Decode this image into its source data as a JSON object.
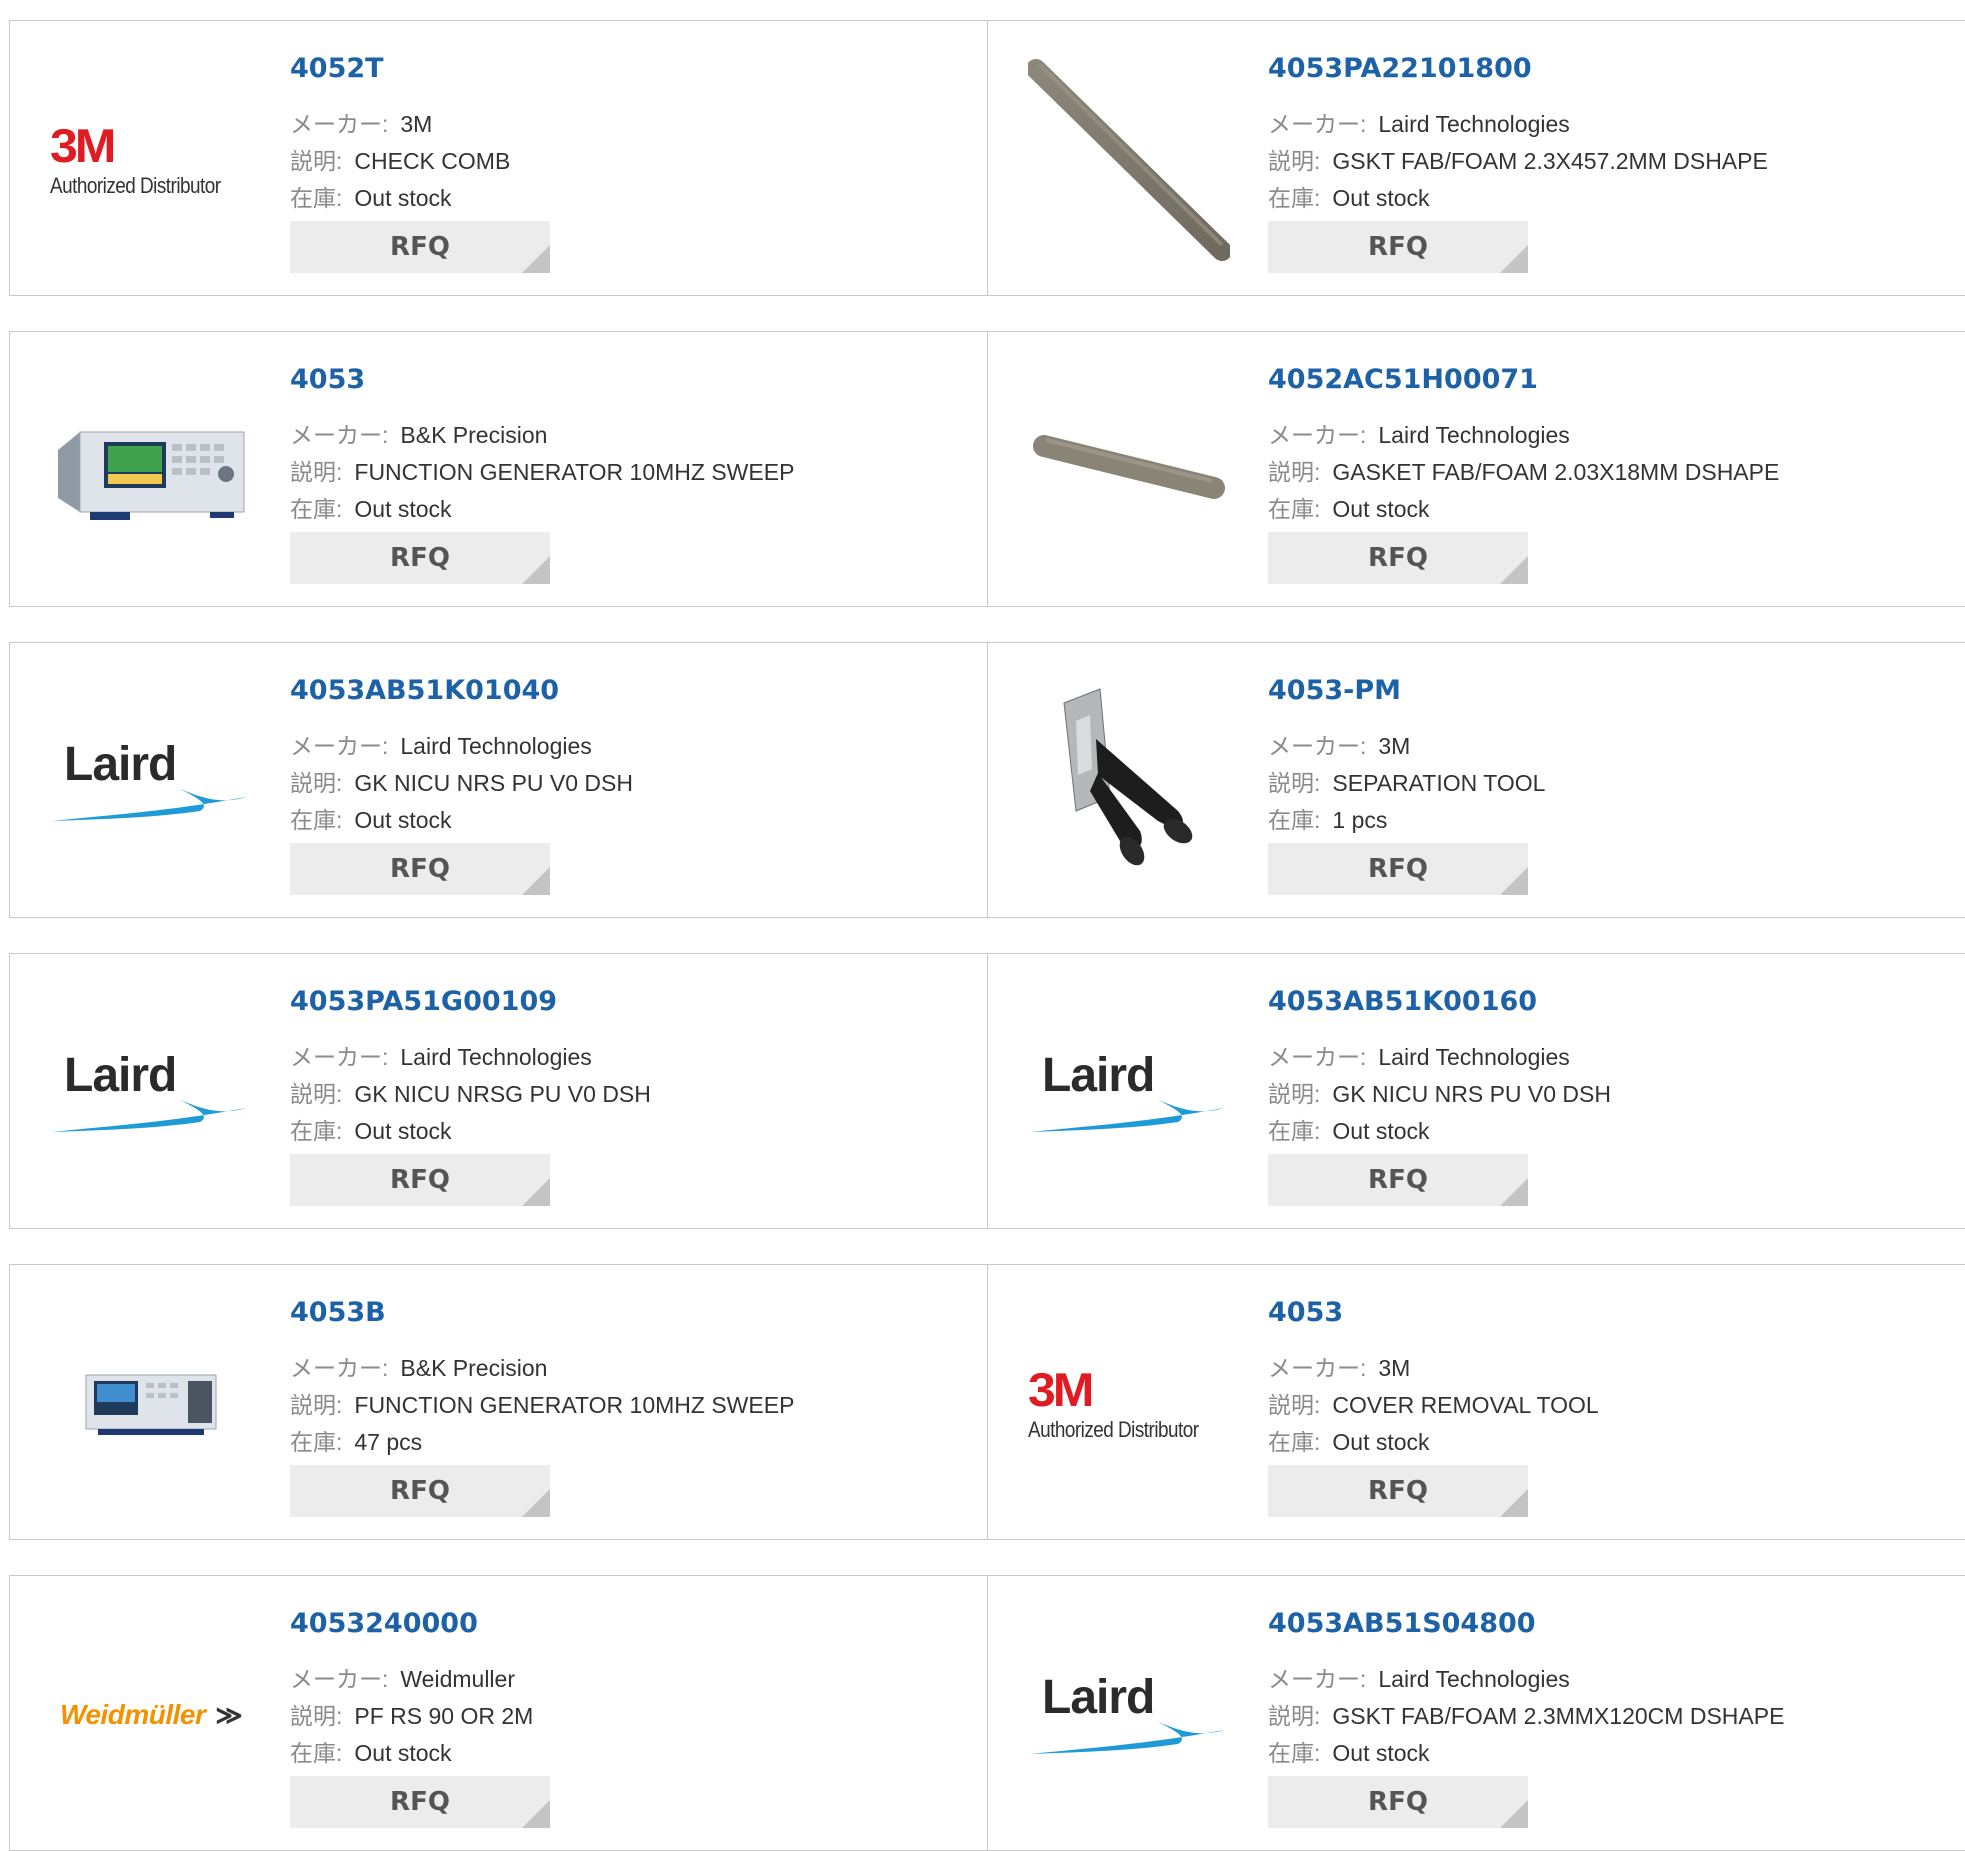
{
  "labels": {
    "maker": "メーカー:",
    "description": "説明:",
    "stock": "在庫:",
    "rfq": "RFQ"
  },
  "logos": {
    "3m_mark": "3M",
    "3m_text": "Authorized Distributor",
    "laird_text": "Laird",
    "weidmuller_text": "Weidmüller",
    "weidmuller_mark": "≫"
  },
  "products": [
    {
      "part_number": "4052T",
      "maker": "3M",
      "description": "CHECK COMB",
      "stock": "Out stock",
      "image": "3m-logo"
    },
    {
      "part_number": "4053PA22101800",
      "maker": "Laird Technologies",
      "description": "GSKT FAB/FOAM 2.3X457.2MM DSHAPE",
      "stock": "Out stock",
      "image": "gasket-long"
    },
    {
      "part_number": "4053",
      "maker": "B&K Precision",
      "description": "FUNCTION GENERATOR 10MHZ SWEEP",
      "stock": "Out stock",
      "image": "function-generator"
    },
    {
      "part_number": "4052AC51H00071",
      "maker": "Laird Technologies",
      "description": "GASKET FAB/FOAM 2.03X18MM DSHAPE",
      "stock": "Out stock",
      "image": "gasket-short"
    },
    {
      "part_number": "4053AB51K01040",
      "maker": "Laird Technologies",
      "description": "GK NICU NRS PU V0 DSH",
      "stock": "Out stock",
      "image": "laird-logo"
    },
    {
      "part_number": "4053-PM",
      "maker": "3M",
      "description": "SEPARATION TOOL",
      "stock": "1 pcs",
      "image": "separation-tool"
    },
    {
      "part_number": "4053PA51G00109",
      "maker": "Laird Technologies",
      "description": "GK NICU NRSG PU V0 DSH",
      "stock": "Out stock",
      "image": "laird-logo"
    },
    {
      "part_number": "4053AB51K00160",
      "maker": "Laird Technologies",
      "description": "GK NICU NRS PU V0 DSH",
      "stock": "Out stock",
      "image": "laird-logo"
    },
    {
      "part_number": "4053B",
      "maker": "B&K Precision",
      "description": "FUNCTION GENERATOR 10MHZ SWEEP",
      "stock": "47 pcs",
      "image": "function-generator-small"
    },
    {
      "part_number": "4053",
      "maker": "3M",
      "description": "COVER REMOVAL TOOL",
      "stock": "Out stock",
      "image": "3m-logo"
    },
    {
      "part_number": "4053240000",
      "maker": "Weidmuller",
      "description": "PF RS 90 OR 2M",
      "stock": "Out stock",
      "image": "weidmuller-logo"
    },
    {
      "part_number": "4053AB51S04800",
      "maker": "Laird Technologies",
      "description": "GSKT FAB/FOAM 2.3MMX120CM DSHAPE",
      "stock": "Out stock",
      "image": "laird-logo"
    }
  ],
  "colors": {
    "part_number": "#1d62a6",
    "border": "#c8c8c8",
    "button": "#ececec",
    "brand_3m": "#e11b22",
    "brand_weidmuller": "#f39200",
    "laird_swoosh": "#1e9bd7"
  }
}
